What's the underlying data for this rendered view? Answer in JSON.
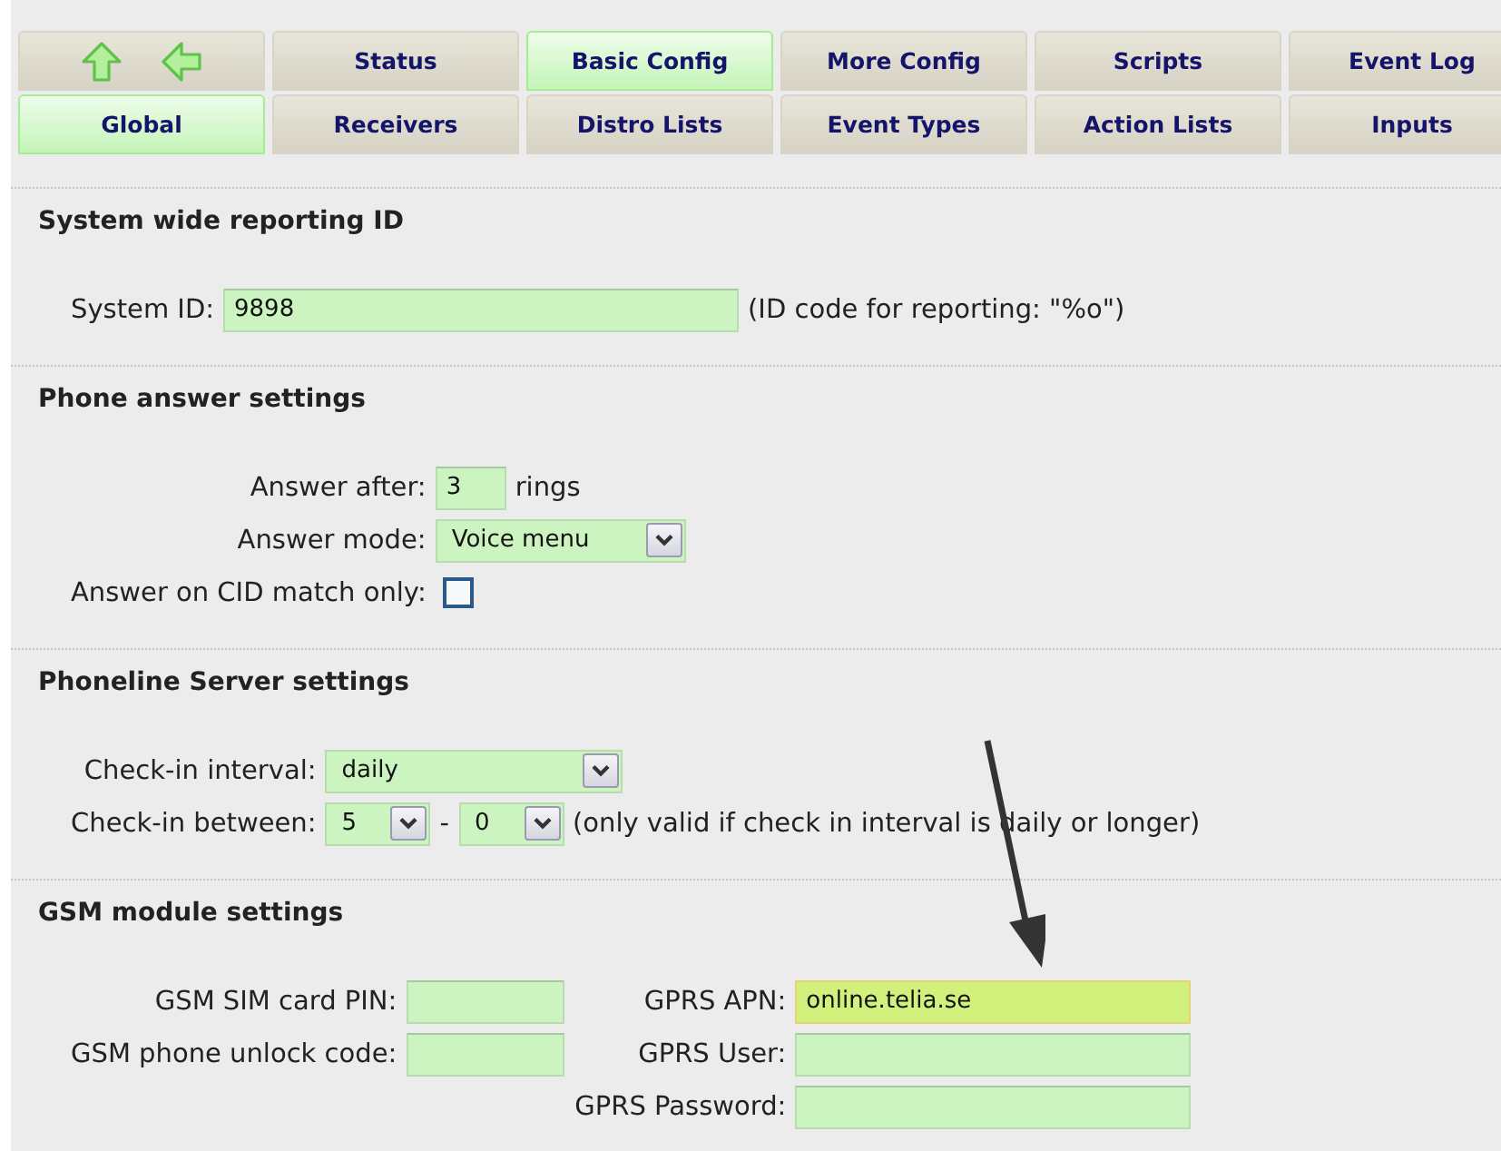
{
  "nav": {
    "rows": [
      [
        {
          "kind": "arrows",
          "selected": false
        },
        {
          "kind": "tab",
          "label": "Status",
          "selected": false
        },
        {
          "kind": "tab",
          "label": "Basic Config",
          "selected": true
        },
        {
          "kind": "tab",
          "label": "More Config",
          "selected": false
        },
        {
          "kind": "tab",
          "label": "Scripts",
          "selected": false
        },
        {
          "kind": "tab",
          "label": "Event Log",
          "selected": false
        }
      ],
      [
        {
          "kind": "tab",
          "label": "Global",
          "selected": true
        },
        {
          "kind": "tab",
          "label": "Receivers",
          "selected": false
        },
        {
          "kind": "tab",
          "label": "Distro Lists",
          "selected": false
        },
        {
          "kind": "tab",
          "label": "Event Types",
          "selected": false
        },
        {
          "kind": "tab",
          "label": "Action Lists",
          "selected": false
        },
        {
          "kind": "tab",
          "label": "Inputs",
          "selected": false
        }
      ]
    ]
  },
  "sections": [
    {
      "title": "System wide reporting ID",
      "columns": [
        [
          {
            "label": "System ID:",
            "controls": [
              {
                "kind": "input",
                "value": "9898",
                "focused": false
              },
              {
                "kind": "text",
                "text": "(ID code for reporting: \"%o\")"
              }
            ]
          }
        ]
      ]
    },
    {
      "title": "Phone answer settings",
      "columns": [
        [
          {
            "label": "Answer after:",
            "controls": [
              {
                "kind": "input",
                "value": "3",
                "focused": false
              },
              {
                "kind": "text",
                "text": "rings"
              }
            ]
          },
          {
            "label": "Answer mode:",
            "controls": [
              {
                "kind": "select",
                "value": "Voice menu"
              }
            ]
          },
          {
            "label": "Answer on CID match only:",
            "controls": [
              {
                "kind": "checkbox",
                "checked": false
              }
            ]
          }
        ]
      ]
    },
    {
      "title": "Phoneline Server settings",
      "columns": [
        [
          {
            "label": "Check-in interval:",
            "controls": [
              {
                "kind": "select",
                "value": "daily"
              }
            ]
          },
          {
            "label": "Check-in between:",
            "controls": [
              {
                "kind": "select",
                "value": "5"
              },
              {
                "kind": "text",
                "text": "-"
              },
              {
                "kind": "select",
                "value": "0"
              },
              {
                "kind": "text",
                "text": "(only valid if check in interval is daily or longer)"
              }
            ]
          }
        ]
      ]
    },
    {
      "title": "GSM module settings",
      "columns": [
        [
          {
            "label": "GSM SIM card PIN:",
            "controls": [
              {
                "kind": "input",
                "focused": false
              }
            ]
          },
          {
            "label": "GSM phone unlock code:",
            "controls": [
              {
                "kind": "input",
                "focused": false
              }
            ]
          }
        ],
        [
          {
            "label": "GPRS APN:",
            "controls": [
              {
                "kind": "input",
                "value": "online.telia.se",
                "focused": true
              }
            ]
          },
          {
            "label": "GPRS User:",
            "controls": [
              {
                "kind": "input",
                "focused": false
              }
            ]
          },
          {
            "label": "GPRS Password:",
            "controls": [
              {
                "kind": "input",
                "focused": false
              }
            ]
          }
        ]
      ]
    }
  ]
}
